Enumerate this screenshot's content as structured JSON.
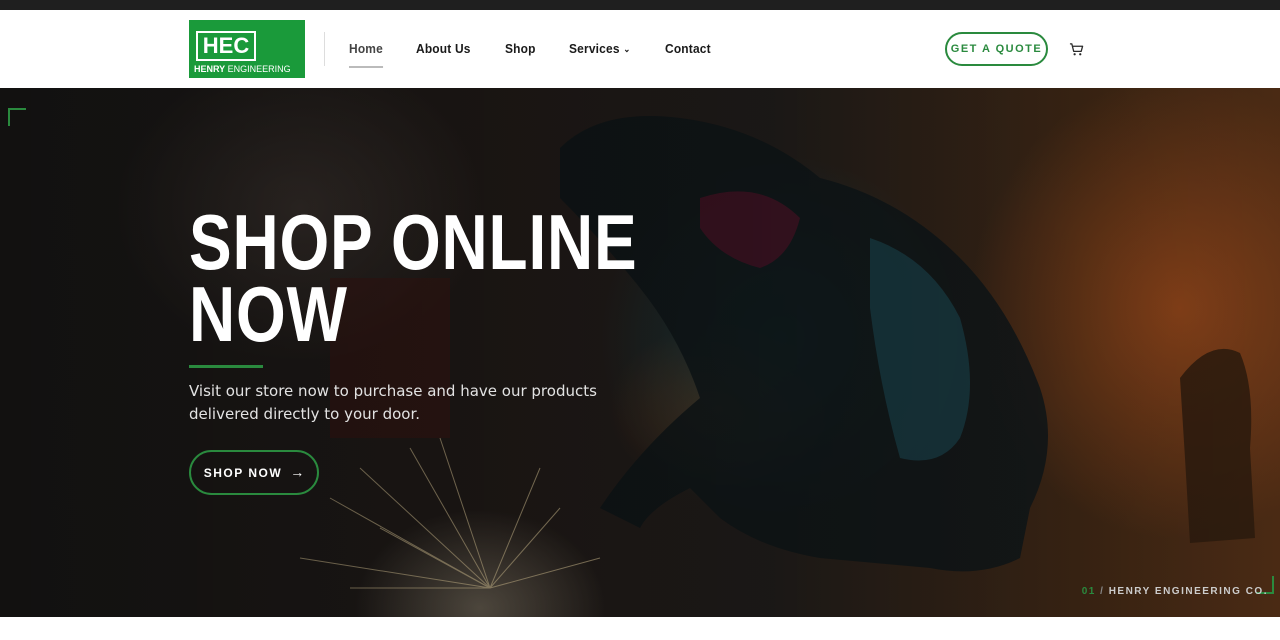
{
  "logo": {
    "mark": "HEC",
    "name_bold": "HENRY",
    "name_rest": " ENGINEERING",
    "brand_color": "#1a9a3a"
  },
  "nav": {
    "items": [
      {
        "label": "Home",
        "active": true
      },
      {
        "label": "About Us"
      },
      {
        "label": "Shop"
      },
      {
        "label": "Services",
        "has_dropdown": true
      },
      {
        "label": "Contact"
      }
    ]
  },
  "header": {
    "quote_button": "GET A QUOTE",
    "cart_icon": "cart-icon"
  },
  "hero": {
    "title_line1": "SHOP ONLINE",
    "title_line2": "NOW",
    "description": "Visit our store now to purchase and have our products delivered directly to your door.",
    "cta_label": "SHOP NOW",
    "cta_icon": "arrow-right-icon",
    "slide_number": "01",
    "slide_separator": "/",
    "slide_caption": "HENRY ENGINEERING CO."
  },
  "colors": {
    "accent": "#2a8a3e",
    "topbar": "#1f1f1f"
  }
}
